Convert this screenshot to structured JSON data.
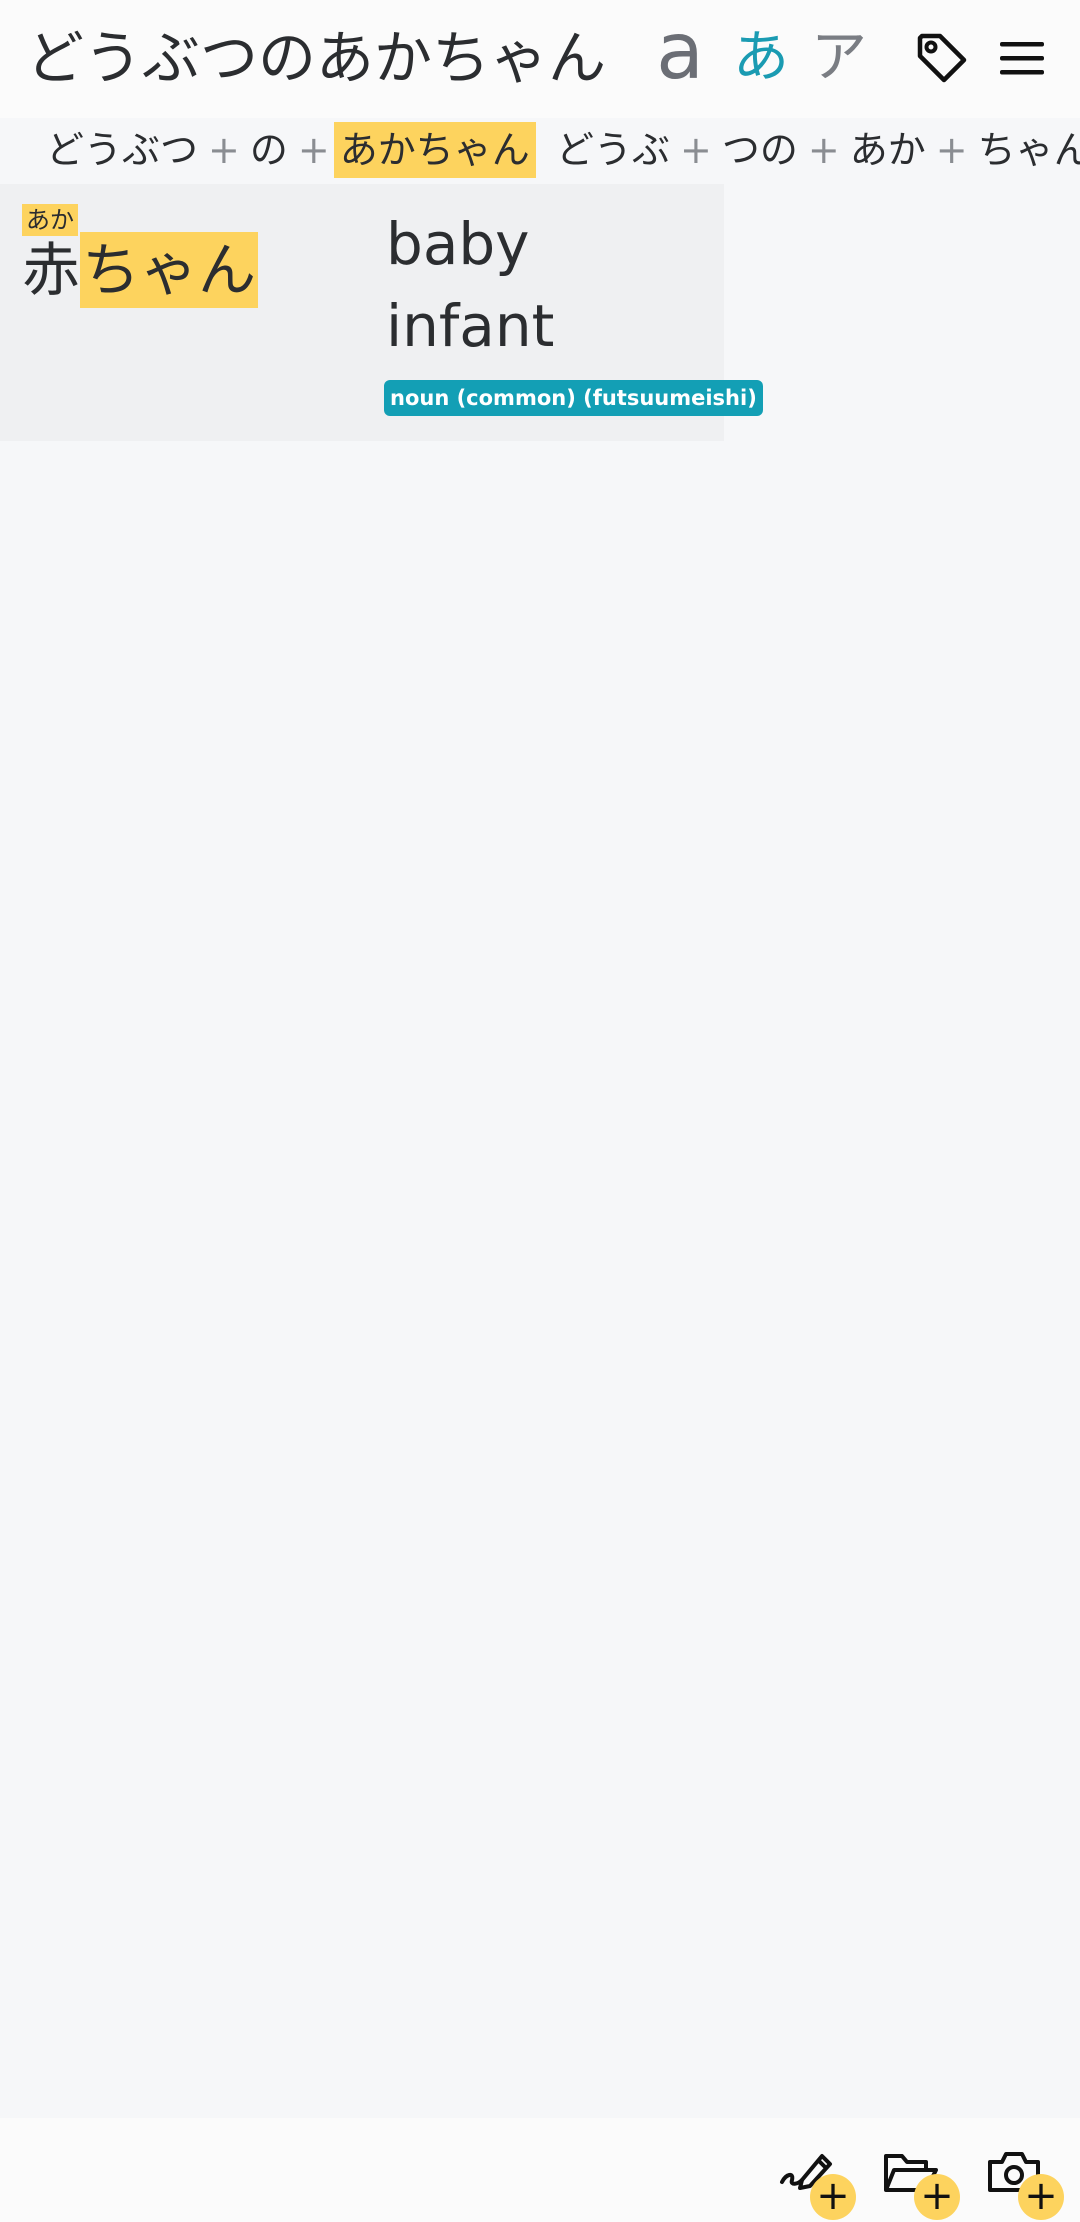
{
  "header": {
    "title": "どうぶつのあかちゃん",
    "script_latin": "a",
    "script_hiragana": "あ",
    "script_katakana": "ア",
    "tag_icon": "tag-icon",
    "menu_icon": "hamburger-menu-icon"
  },
  "segmentations": [
    {
      "parts": [
        {
          "text": "どうぶつ",
          "highlighted": false
        },
        {
          "text": "の",
          "highlighted": false
        },
        {
          "text": "あかちゃん",
          "highlighted": true
        }
      ]
    },
    {
      "parts": [
        {
          "text": "どうぶ",
          "highlighted": false
        },
        {
          "text": "つの",
          "highlighted": false
        },
        {
          "text": "あか",
          "highlighted": false
        },
        {
          "text": "ちゃん",
          "highlighted": false
        }
      ]
    }
  ],
  "separator": "+",
  "entry": {
    "furigana": "あか",
    "kanji": "赤",
    "kana": "ちゃん",
    "glosses": [
      "baby",
      "infant"
    ],
    "part_of_speech": "noun (common) (futsuumeishi)"
  },
  "footer": {
    "buttons": [
      {
        "icon": "draw-icon",
        "badge": "+"
      },
      {
        "icon": "folder-open-icon",
        "badge": "+"
      },
      {
        "icon": "camera-icon",
        "badge": "+"
      }
    ]
  },
  "colors": {
    "highlight": "#fdd35e",
    "accent": "#139fb5",
    "hiragana_active": "#1a9bb2"
  }
}
